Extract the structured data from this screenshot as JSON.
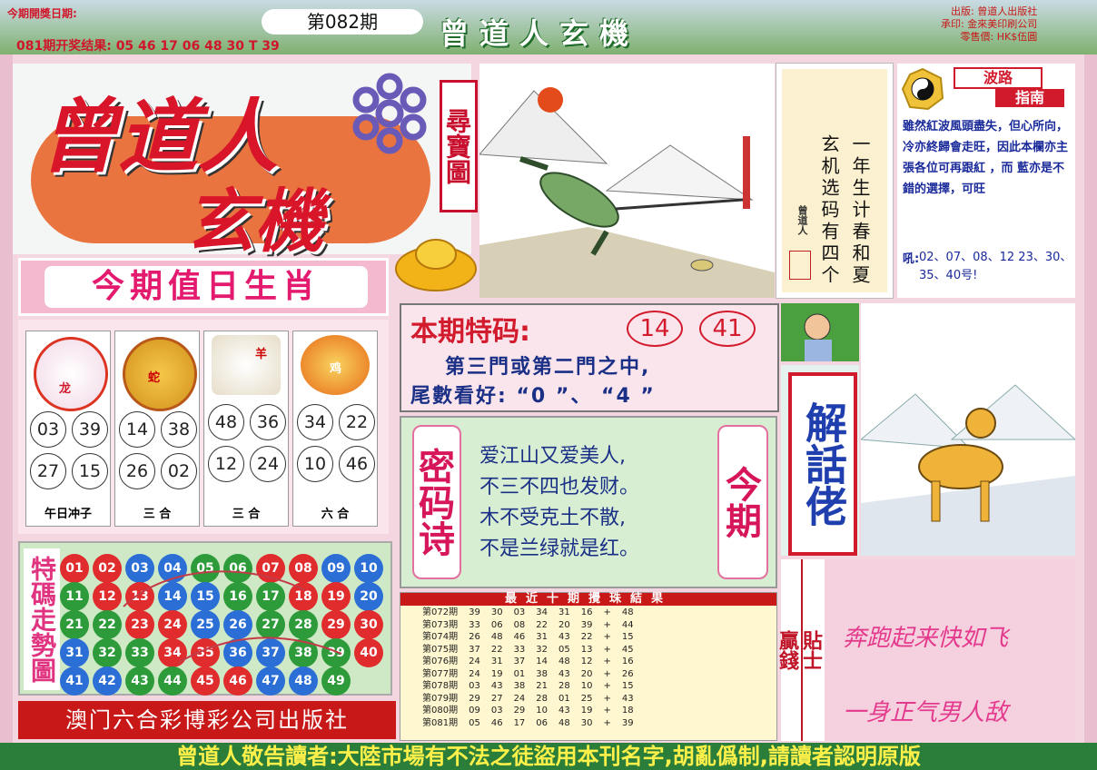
{
  "header": {
    "date_label": "今期開獎日期:",
    "result_label": "081期开奖结果: 05 46 17 06 48 30 T 39",
    "issue": "第082期",
    "banner_title": "曾道人玄機",
    "publisher_lines": [
      "出版: 曾道人出版社",
      "承印: 金來美印刷公司",
      "零售價: HK$伍圓"
    ]
  },
  "logo": {
    "line1": "曾道人",
    "line2": "玄機",
    "tag": "尋寶圖"
  },
  "poem_panel": {
    "col1": "一年生计春和夏",
    "col2": "玄机选码有四个",
    "signature": "曾道人"
  },
  "guide": {
    "title_top": "波路",
    "title_bottom": "指南",
    "text": "雖然紅波風頭盡失，但心所向，冷亦終歸會走旺，因此本欄亦主張各位可再跟紅 ，而 藍亦是不錯的選擇，可旺",
    "numbers_prefix": "吼:",
    "numbers": "02、07、08、12 23、30、35、40号!"
  },
  "zodiac": {
    "title": "今期值日生肖",
    "animals": [
      {
        "name": "龙",
        "icon": "dragon-icon",
        "nums": [
          "03",
          "39",
          "27",
          "15"
        ],
        "label": "午日冲子"
      },
      {
        "name": "蛇",
        "icon": "snake-icon",
        "nums": [
          "14",
          "38",
          "26",
          "02"
        ],
        "label": "三 合"
      },
      {
        "name": "羊",
        "icon": "goat-icon",
        "nums": [
          "48",
          "36",
          "12",
          "24"
        ],
        "label": "三 合"
      },
      {
        "name": "鸡",
        "icon": "rooster-icon",
        "nums": [
          "34",
          "22",
          "10",
          "46"
        ],
        "label": "六 合"
      }
    ]
  },
  "special": {
    "title": "本期特码:",
    "n1": "14",
    "n2": "41",
    "line1": "第三門或第二門之中,",
    "line2": "尾數看好: “0 ”、 “4 ”"
  },
  "secret_poem": {
    "left_tag": "密码诗",
    "right_tag": "今期",
    "lines": [
      "爱江山又爱美人,",
      "不三不四也发财。",
      "木不受克土不散,",
      "不是兰绿就是红。"
    ]
  },
  "jiehua": {
    "tag": "解話佬"
  },
  "trend": {
    "title": "特碼走勢圖",
    "balls": [
      [
        "01",
        "r"
      ],
      [
        "02",
        "r"
      ],
      [
        "03",
        "b"
      ],
      [
        "04",
        "b"
      ],
      [
        "05",
        "g"
      ],
      [
        "06",
        "g"
      ],
      [
        "07",
        "r"
      ],
      [
        "08",
        "r"
      ],
      [
        "09",
        "b"
      ],
      [
        "10",
        "b"
      ],
      [
        "11",
        "g"
      ],
      [
        "12",
        "r"
      ],
      [
        "13",
        "r"
      ],
      [
        "14",
        "b"
      ],
      [
        "15",
        "b"
      ],
      [
        "16",
        "g"
      ],
      [
        "17",
        "g"
      ],
      [
        "18",
        "r"
      ],
      [
        "19",
        "r"
      ],
      [
        "20",
        "b"
      ],
      [
        "21",
        "g"
      ],
      [
        "22",
        "g"
      ],
      [
        "23",
        "r"
      ],
      [
        "24",
        "r"
      ],
      [
        "25",
        "b"
      ],
      [
        "26",
        "b"
      ],
      [
        "27",
        "g"
      ],
      [
        "28",
        "g"
      ],
      [
        "29",
        "r"
      ],
      [
        "30",
        "r"
      ],
      [
        "31",
        "b"
      ],
      [
        "32",
        "g"
      ],
      [
        "33",
        "g"
      ],
      [
        "34",
        "r"
      ],
      [
        "35",
        "r"
      ],
      [
        "36",
        "b"
      ],
      [
        "37",
        "b"
      ],
      [
        "38",
        "g"
      ],
      [
        "39",
        "g"
      ],
      [
        "40",
        "r"
      ],
      [
        "41",
        "b"
      ],
      [
        "42",
        "b"
      ],
      [
        "43",
        "g"
      ],
      [
        "44",
        "g"
      ],
      [
        "45",
        "r"
      ],
      [
        "46",
        "r"
      ],
      [
        "47",
        "b"
      ],
      [
        "48",
        "b"
      ],
      [
        "49",
        "g"
      ]
    ]
  },
  "history": {
    "title": "最近十期攪珠結果",
    "rows": [
      [
        "第072期",
        "39",
        "30",
        "03",
        "34",
        "31",
        "16",
        "+",
        "48"
      ],
      [
        "第073期",
        "33",
        "06",
        "08",
        "22",
        "20",
        "39",
        "+",
        "44"
      ],
      [
        "第074期",
        "26",
        "48",
        "46",
        "31",
        "43",
        "22",
        "+",
        "15"
      ],
      [
        "第075期",
        "37",
        "22",
        "33",
        "32",
        "05",
        "13",
        "+",
        "45"
      ],
      [
        "第076期",
        "24",
        "31",
        "37",
        "14",
        "48",
        "12",
        "+",
        "16"
      ],
      [
        "第077期",
        "24",
        "19",
        "01",
        "38",
        "43",
        "20",
        "+",
        "26"
      ],
      [
        "第078期",
        "03",
        "43",
        "38",
        "21",
        "28",
        "10",
        "+",
        "15"
      ],
      [
        "第079期",
        "29",
        "27",
        "24",
        "28",
        "01",
        "25",
        "+",
        "43"
      ],
      [
        "第080期",
        "09",
        "03",
        "29",
        "10",
        "43",
        "19",
        "+",
        "18"
      ],
      [
        "第081期",
        "05",
        "46",
        "17",
        "06",
        "48",
        "30",
        "+",
        "39"
      ]
    ]
  },
  "tips": {
    "tag_left": "贏錢",
    "tag_right": "貼士",
    "line1": "奔跑起来快如飞",
    "line2": "一身正气男人敌"
  },
  "publisher_bar": "澳门六合彩博彩公司出版社",
  "footer": "曾道人敬告讀者:大陸市場有不法之徒盜用本刊名字,胡亂僞制,請讀者認明原版"
}
